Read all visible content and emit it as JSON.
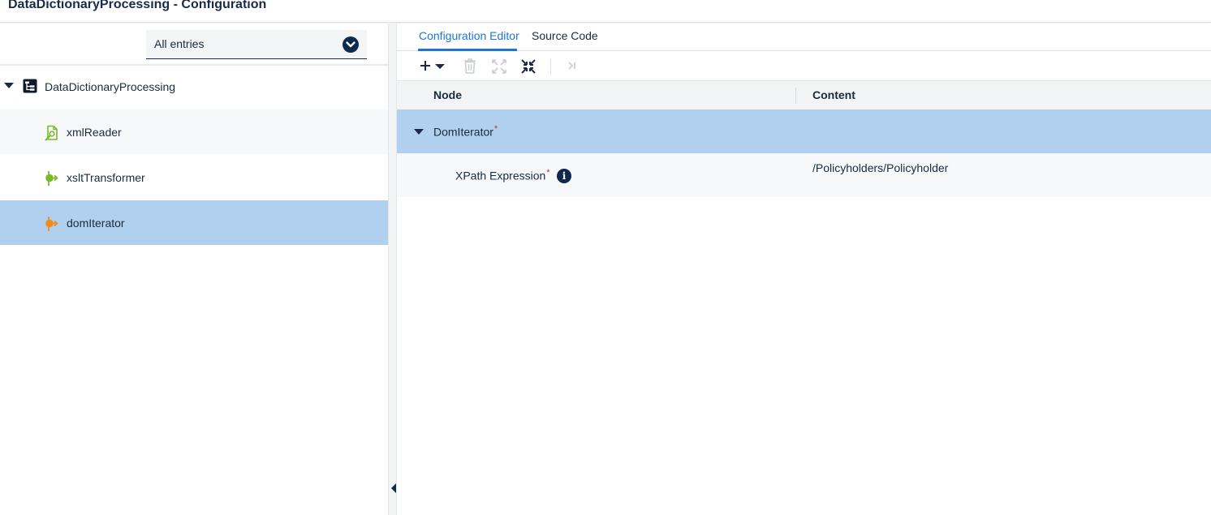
{
  "app": {
    "title": "DataDictionaryProcessing - Configuration"
  },
  "filter": {
    "value": "All entries",
    "icon": "chevron-down-icon"
  },
  "tree": {
    "root": {
      "label": "DataDictionaryProcessing",
      "icon": "hierarchy-icon",
      "expanded": true
    },
    "items": [
      {
        "label": "xmlReader",
        "icon": "xml-reader-icon",
        "color": "#7ab929"
      },
      {
        "label": "xsltTransformer",
        "icon": "transformer-icon",
        "color": "#7ab929"
      },
      {
        "label": "domIterator",
        "icon": "iterator-icon",
        "color": "#f08c1c",
        "selected": true
      }
    ]
  },
  "tabs": [
    {
      "label": "Configuration Editor",
      "active": true
    },
    {
      "label": "Source Code",
      "active": false
    }
  ],
  "toolbar": {
    "buttons": [
      {
        "name": "add-icon",
        "enabled": true
      },
      {
        "name": "delete-icon",
        "enabled": false
      },
      {
        "name": "expand-all-icon",
        "enabled": false
      },
      {
        "name": "collapse-all-icon",
        "enabled": true
      },
      {
        "name": "skip-icon",
        "enabled": false
      }
    ]
  },
  "grid": {
    "columns": {
      "node": "Node",
      "content": "Content"
    },
    "rows": [
      {
        "node": "DomIterator",
        "required": "*",
        "content": "",
        "expanded": true
      },
      {
        "node": "XPath Expression",
        "required": "*",
        "content": "/Policyholders/Policyholder",
        "info": "i"
      }
    ]
  },
  "colors": {
    "selection": "#b1cfee",
    "accent": "#1a76d2",
    "navy": "#0f2a4e",
    "green": "#7ab929",
    "orange": "#f08c1c",
    "required": "#d92b2b"
  }
}
